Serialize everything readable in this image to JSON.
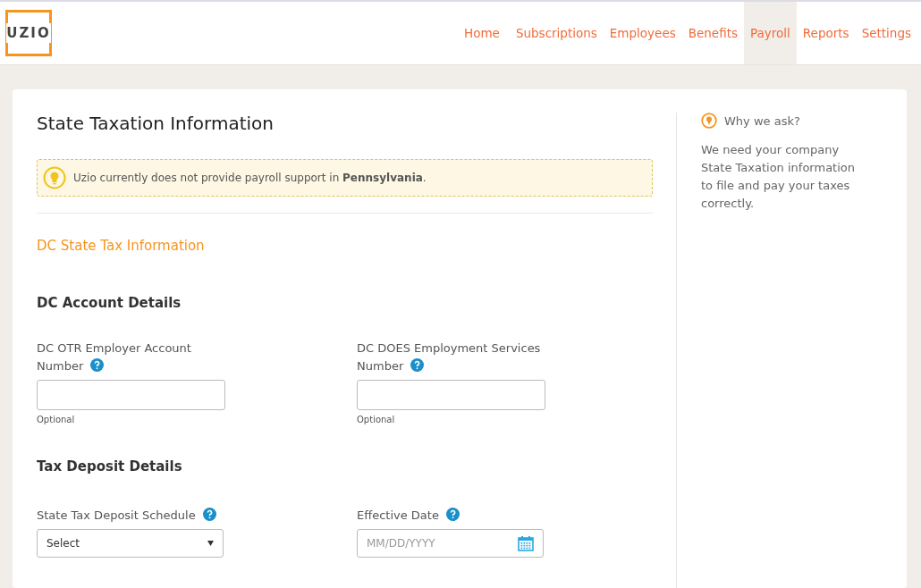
{
  "logo": {
    "text": "UZIO"
  },
  "nav": [
    {
      "label": "Home",
      "selected": false
    },
    {
      "label": "Subscriptions",
      "selected": false
    },
    {
      "label": "Employees",
      "selected": false
    },
    {
      "label": "Benefits",
      "selected": false
    },
    {
      "label": "Payroll",
      "selected": true
    },
    {
      "label": "Reports",
      "selected": false
    },
    {
      "label": "Settings",
      "selected": false
    }
  ],
  "page_title": "State Taxation Information",
  "alert": "Uzio currently does not provide payroll support in **Pennsylvania**.",
  "section_title": "DC State Tax Information",
  "groups": [
    {
      "heading": "DC Account Details",
      "fields": [
        {
          "kind": "text",
          "label": "DC OTR Employer Account Number",
          "hint": "Optional"
        },
        {
          "kind": "text",
          "label": "DC DOES Employment Services Number",
          "hint": "Optional"
        }
      ]
    },
    {
      "heading": "Tax Deposit Details",
      "fields": [
        {
          "kind": "select",
          "label": "State Tax Deposit Schedule",
          "value": "Select"
        },
        {
          "kind": "date",
          "label": "Effective Date",
          "placeholder": "MM/DD/YYYY"
        }
      ]
    }
  ],
  "sidebar": {
    "title": "Why we ask?",
    "text": "We need your company State Taxation information to file and pay your taxes correctly."
  }
}
